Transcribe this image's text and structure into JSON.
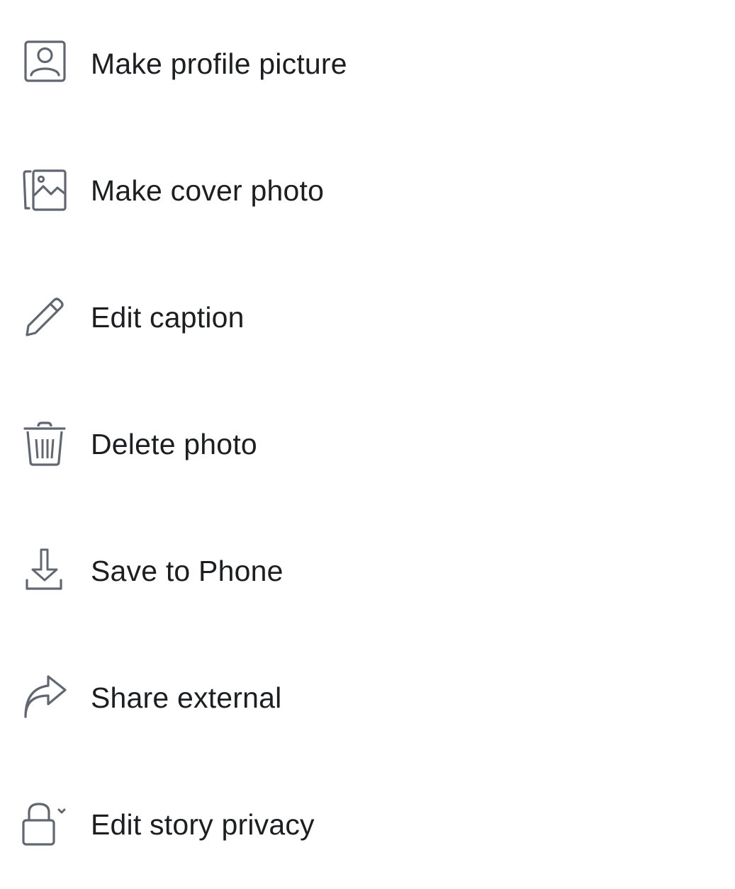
{
  "menu": {
    "items": [
      {
        "label": "Make profile picture",
        "icon": "profile-picture-icon"
      },
      {
        "label": "Make cover photo",
        "icon": "cover-photo-icon"
      },
      {
        "label": "Edit caption",
        "icon": "pencil-icon"
      },
      {
        "label": "Delete photo",
        "icon": "trash-icon"
      },
      {
        "label": "Save to Phone",
        "icon": "download-icon"
      },
      {
        "label": "Share external",
        "icon": "share-arrow-icon"
      },
      {
        "label": "Edit story privacy",
        "icon": "lock-dropdown-icon"
      }
    ]
  },
  "colors": {
    "icon_stroke": "#606770",
    "label_text": "#1c1e21",
    "background": "#ffffff"
  }
}
